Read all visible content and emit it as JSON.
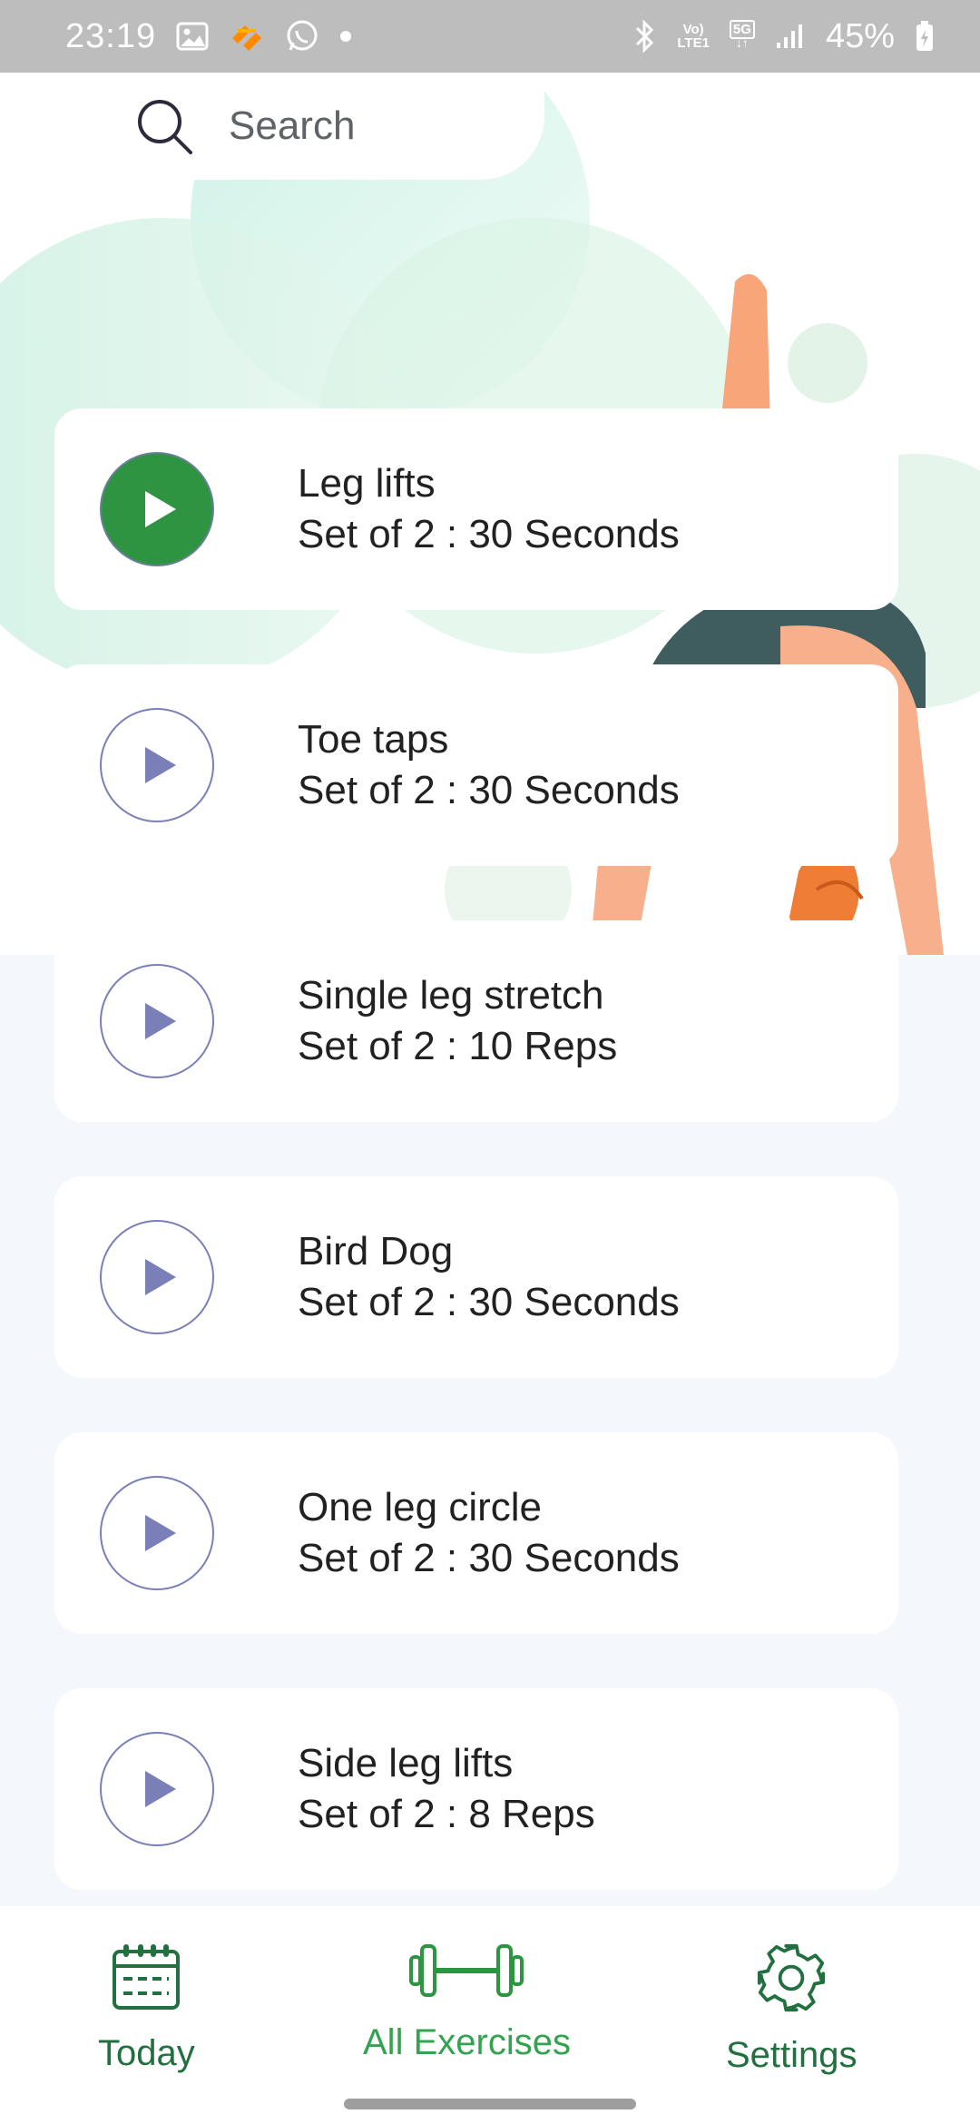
{
  "status_bar": {
    "time": "23:19",
    "battery_pct": "45%",
    "network_label_top": "Vo)",
    "network_label_bottom": "LTE1",
    "network_type": "5G",
    "icons_left": [
      "gallery-icon",
      "app-notification-icon",
      "whatsapp-icon",
      "dot-icon"
    ],
    "icons_right": [
      "bluetooth-icon",
      "volte-icon",
      "5g-icon",
      "signal-icon",
      "battery-icon"
    ]
  },
  "search": {
    "placeholder": "Search",
    "value": ""
  },
  "exercises": [
    {
      "name": "Leg lifts",
      "detail": "Set of 2 : 30 Seconds",
      "active": true
    },
    {
      "name": "Toe taps",
      "detail": "Set of 2 : 30 Seconds",
      "active": false
    },
    {
      "name": "Single leg stretch",
      "detail": "Set of 2 : 10 Reps",
      "active": false
    },
    {
      "name": "Bird Dog",
      "detail": "Set of 2 : 30 Seconds",
      "active": false
    },
    {
      "name": "One leg circle",
      "detail": "Set of 2 : 30 Seconds",
      "active": false
    },
    {
      "name": "Side leg lifts",
      "detail": "Set of 2 : 8 Reps",
      "active": false
    }
  ],
  "bottom_nav": {
    "items": [
      {
        "label": "Today",
        "icon": "calendar-icon",
        "selected": false
      },
      {
        "label": "All Exercises",
        "icon": "dumbbell-icon",
        "selected": true
      },
      {
        "label": "Settings",
        "icon": "gear-icon",
        "selected": false
      }
    ]
  },
  "colors": {
    "accent_green": "#2e9441",
    "nav_green": "#22703f",
    "play_outline": "#7b7fb8",
    "list_background": "#f4f8fc"
  }
}
